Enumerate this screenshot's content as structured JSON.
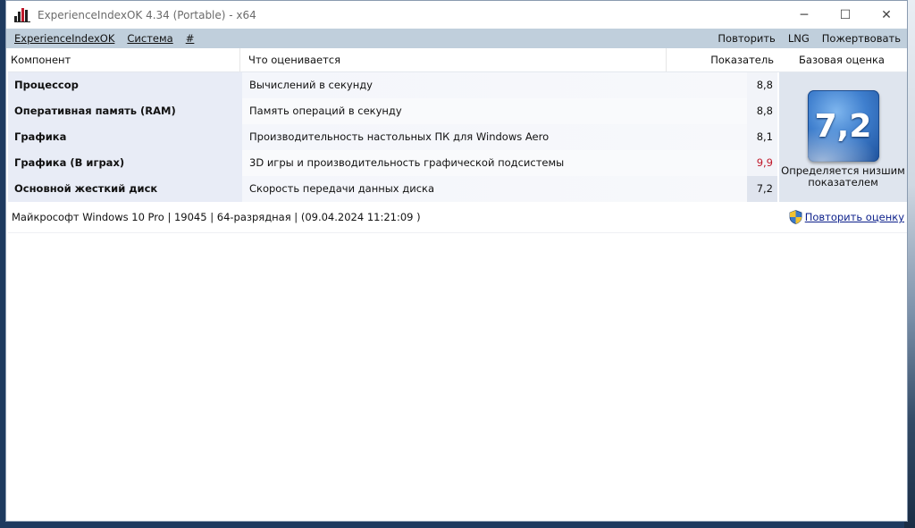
{
  "window": {
    "title": "ExperienceIndexOK 4.34 (Portable) - x64",
    "controls": {
      "minimize": "─",
      "maximize": "☐",
      "close": "✕"
    }
  },
  "menu": {
    "left": [
      "ExperienceIndexOK",
      "Система",
      "#"
    ],
    "right": [
      "Повторить",
      "LNG",
      "Пожертвовать"
    ]
  },
  "table": {
    "headers": {
      "component": "Компонент",
      "what": "Что оценивается",
      "score": "Показатель",
      "base": "Базовая оценка"
    },
    "rows": [
      {
        "component": "Процессор",
        "what": "Вычислений в секунду",
        "score": "8,8"
      },
      {
        "component": "Оперативная память (RAM)",
        "what": "Память операций в секунду",
        "score": "8,8"
      },
      {
        "component": "Графика",
        "what": "Производительность настольных ПК для Windows Aero",
        "score": "8,1"
      },
      {
        "component": "Графика (В играх)",
        "what": "3D игры и производительность графической подсистемы",
        "score": "9,9"
      },
      {
        "component": "Основной жесткий диск",
        "what": "Скорость передачи данных диска",
        "score": "7,2"
      }
    ],
    "highlight_color": "#c0182a"
  },
  "base_score": {
    "value": "7,2",
    "caption": "Определяется низшим показателем"
  },
  "status": {
    "system": "Майкрософт Windows 10 Pro | 19045 | 64-разрядная | (09.04.2024 11:21:09 )",
    "rerun_link": "Повторить оценку"
  }
}
